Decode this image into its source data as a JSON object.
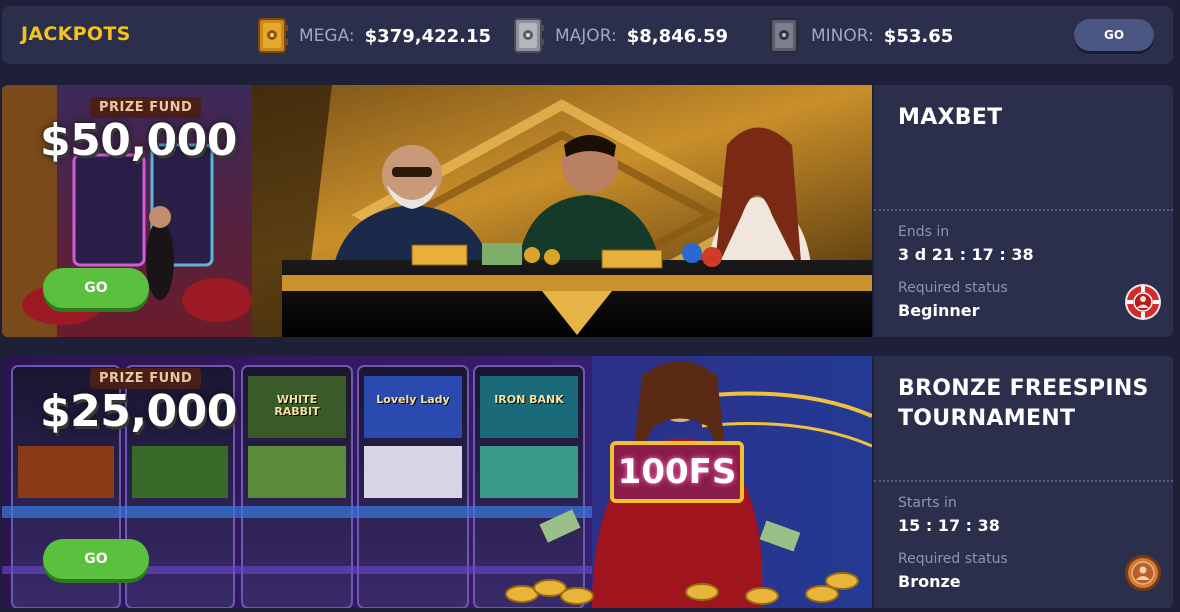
{
  "jackpots": {
    "title": "JACKPOTS",
    "items": [
      {
        "label": "MEGA:",
        "value": "$379,422.15",
        "icon": "safe-gold-icon"
      },
      {
        "label": "MAJOR:",
        "value": "$8,846.59",
        "icon": "safe-silver-icon"
      },
      {
        "label": "MINOR:",
        "value": "$53.65",
        "icon": "safe-dark-icon"
      }
    ],
    "go_label": "GO"
  },
  "tournaments": [
    {
      "title": "MAXBET",
      "prize_label": "PRIZE FUND",
      "prize_amount": "$50,000",
      "go_label": "GO",
      "time_label": "Ends in",
      "time_value": "3 d 21 : 17 : 38",
      "status_label": "Required status",
      "status_value": "Beginner",
      "status_icon": "poker-chip-icon"
    },
    {
      "title": "BRONZE FREESPINS TOURNAMENT",
      "prize_label": "PRIZE FUND",
      "prize_amount": "$25,000",
      "go_label": "GO",
      "time_label": "Starts in",
      "time_value": "15 : 17 : 38",
      "status_label": "Required status",
      "status_value": "Bronze",
      "status_icon": "bronze-medal-icon",
      "sign_text": "100FS",
      "slot_titles": [
        "WHITE RABBIT",
        "Lovely Lady",
        "IRON BANK"
      ]
    }
  ],
  "colors": {
    "background": "#1d2036",
    "panel": "#2b2f4b",
    "jackpot_title": "#f5c21b",
    "go_green": "#5bc03e",
    "go_header": "#4b5683"
  }
}
